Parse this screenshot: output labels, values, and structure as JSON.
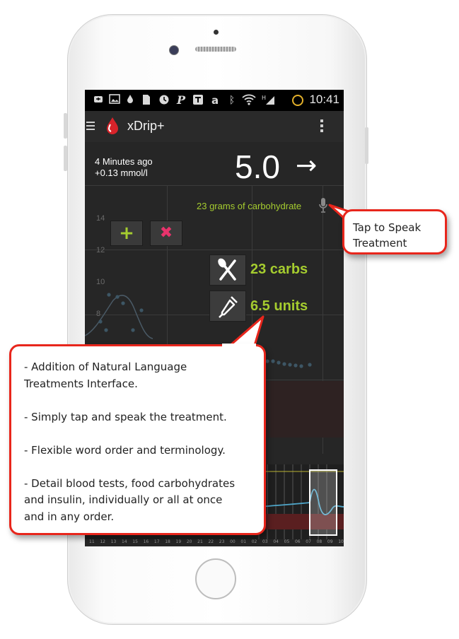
{
  "status_bar": {
    "time": "10:41",
    "icons": [
      "notification-icon",
      "image-icon",
      "drop-icon",
      "document-icon",
      "clock-icon",
      "pinterest-icon",
      "text-icon",
      "amazon-icon",
      "bluetooth-icon",
      "wifi-icon",
      "signal-icon",
      "battery-icon"
    ]
  },
  "app_bar": {
    "title": "xDrip+"
  },
  "reading": {
    "time_ago": "4 Minutes ago",
    "delta": "+0.13 mmol/l",
    "value": "5.0",
    "trend_arrow": "→"
  },
  "voice": {
    "text": "23 grams of carbohydrate"
  },
  "chart": {
    "y_ticks": [
      "14",
      "12",
      "10",
      "8"
    ]
  },
  "treatments": [
    {
      "icon": "cutlery-icon",
      "label": "23 carbs"
    },
    {
      "icon": "syringe-icon",
      "label": "6.5 units"
    }
  ],
  "mini_buttons": {
    "add": "+",
    "cancel": "✖"
  },
  "preview_ticks": [
    "11",
    "12",
    "13",
    "14",
    "15",
    "16",
    "17",
    "18",
    "19",
    "20",
    "21",
    "22",
    "23",
    "00",
    "01",
    "02",
    "03",
    "04",
    "05",
    "06",
    "07",
    "08",
    "09",
    "10"
  ],
  "callouts": {
    "speak": {
      "line1": "Tap to Speak",
      "line2": "Treatment"
    },
    "features": {
      "p1a": "- Addition of Natural Language",
      "p1b": "Treatments Interface.",
      "p2": "- Simply tap and speak the treatment.",
      "p3": "- Flexible word order and terminology.",
      "p4a": "- Detail blood tests, food carbohydrates",
      "p4b": "and insulin, individually or all at once",
      "p4c": "and in any order."
    }
  },
  "colors": {
    "accent_green": "#a5cc2f",
    "callout_border": "#e8261c",
    "cancel_pink": "#e8336c",
    "glucose_line": "#4fa6c9"
  }
}
